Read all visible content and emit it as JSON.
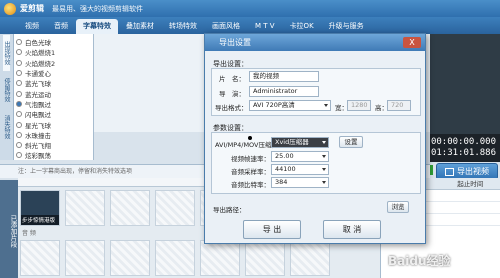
{
  "app": {
    "title": "爱剪辑",
    "tagline": "最易用、强大的视频剪辑软件"
  },
  "tabs": [
    {
      "label": "视频"
    },
    {
      "label": "音频"
    },
    {
      "label": "字幕特效"
    },
    {
      "label": "叠加素材"
    },
    {
      "label": "转场特效"
    },
    {
      "label": "画面风格"
    },
    {
      "label": "M T V"
    },
    {
      "label": "卡拉OK"
    },
    {
      "label": "升级与服务"
    }
  ],
  "categories": [
    "出现特效",
    "停留特效",
    "消失特效"
  ],
  "effects": [
    "白色光球",
    "火焰燃烧1",
    "火焰燃烧2",
    "卡通爱心",
    "蓝光飞球",
    "蓝光运动",
    "气泡飘过",
    "闪电飘过",
    "星光飞球",
    "水珠撞击",
    "斜光飞翔",
    "炫彩飘荡"
  ],
  "hint": "注：上一字幕商出现，停留和消失特效选项",
  "timeline": {
    "side_label": "已添加片段",
    "first_clip_label": "步步惊情港版",
    "placeholder_clip": "双击此处添加视频",
    "audio_label": "音 频"
  },
  "right_table": {
    "col1": "",
    "col2": "起止时间"
  },
  "timecode": {
    "current": "00:00:00.000",
    "total": "01:31:01.886"
  },
  "export_button": "导出视频",
  "dialog": {
    "title": "导出设置",
    "close": "X",
    "section1": "导出设置：",
    "name_label": "片　名：",
    "name_value": "我的视频",
    "author_label": "导　演：",
    "author_value": "Administrator",
    "format_label": "导出格式：",
    "format_value": "AVI 720P高清",
    "width_label": "宽：",
    "width_value": "1280",
    "height_label": "高：",
    "height_value": "720",
    "section2": "参数设置：",
    "codec_label": "AVI/MP4/MOV压缩器：",
    "codec_value": "Xvid压缩器",
    "codec_button": "设置",
    "fps_label": "视频帧速率：",
    "fps_value": "25.00",
    "samplerate_label": "音频采样率：",
    "samplerate_value": "44100",
    "bitrate_label": "音频比特率：",
    "bitrate_value": "384",
    "path_label": "导出路径：",
    "browse": "浏览",
    "export": "导 出",
    "cancel": "取 消"
  },
  "watermark": "Baidu经验"
}
